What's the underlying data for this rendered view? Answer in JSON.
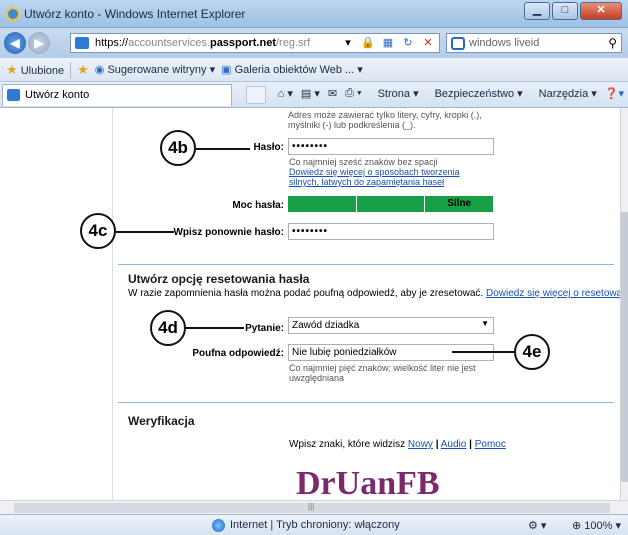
{
  "window": {
    "title": "Utwórz konto - Windows Internet Explorer"
  },
  "address": {
    "url_prefix": "https://",
    "url_plain": "accountservices.",
    "url_bold": "passport.net",
    "url_suffix": "/reg.srf",
    "search_text": "windows liveid"
  },
  "favorites": {
    "label": "Ulubione",
    "suggested": "Sugerowane witryny",
    "gallery": "Galeria obiektów Web ..."
  },
  "tab": {
    "title": "Utwórz konto"
  },
  "commands": {
    "page": "Strona",
    "security": "Bezpieczeństwo",
    "tools": "Narzędzia"
  },
  "form": {
    "address_hint": "Adres może zawierać tylko litery, cyfry, kropki (.), myślniki (-) lub podkreślenia (_).",
    "password_label": "Hasło:",
    "password_value": "••••••••",
    "password_hint": "Co najmniej sześć znaków bez spacji",
    "password_link": "Dowiedz się więcej o sposobach tworzenia silnych, łatwych do zapamiętania haseł",
    "strength_label": "Moc hasła:",
    "strength_value": "Silne",
    "retype_label": "Wpisz ponownie hasło:",
    "retype_value": "••••••••",
    "reset_title": "Utwórz opcję resetowania hasła",
    "reset_desc": "W razie zapomnienia hasła można podać poufną odpowiedź, aby je zresetować.",
    "reset_link": "Dowiedz się więcej o resetowaniu hasła",
    "question_label": "Pytanie:",
    "question_value": "Zawód dziadka",
    "answer_label": "Poufna odpowiedź:",
    "answer_value": "Nie lubię poniedziałków",
    "answer_hint": "Co najmniej pięć znaków; wielkość liter nie jest uwzględniana",
    "verify_title": "Weryfikacja",
    "verify_text": "Wpisz znaki, które widzisz",
    "verify_new": "Nowy",
    "verify_audio": "Audio",
    "verify_help": "Pomoc",
    "captcha_text": "DrUanFB"
  },
  "callouts": {
    "c4b": "4b",
    "c4c": "4c",
    "c4d": "4d",
    "c4e": "4e"
  },
  "status": {
    "text": "Internet | Tryb chroniony: włączony",
    "zoom": "100%"
  },
  "colors": {
    "strength": "#18a046",
    "link": "#1a4fb5",
    "divider": "#8fb9e3"
  }
}
